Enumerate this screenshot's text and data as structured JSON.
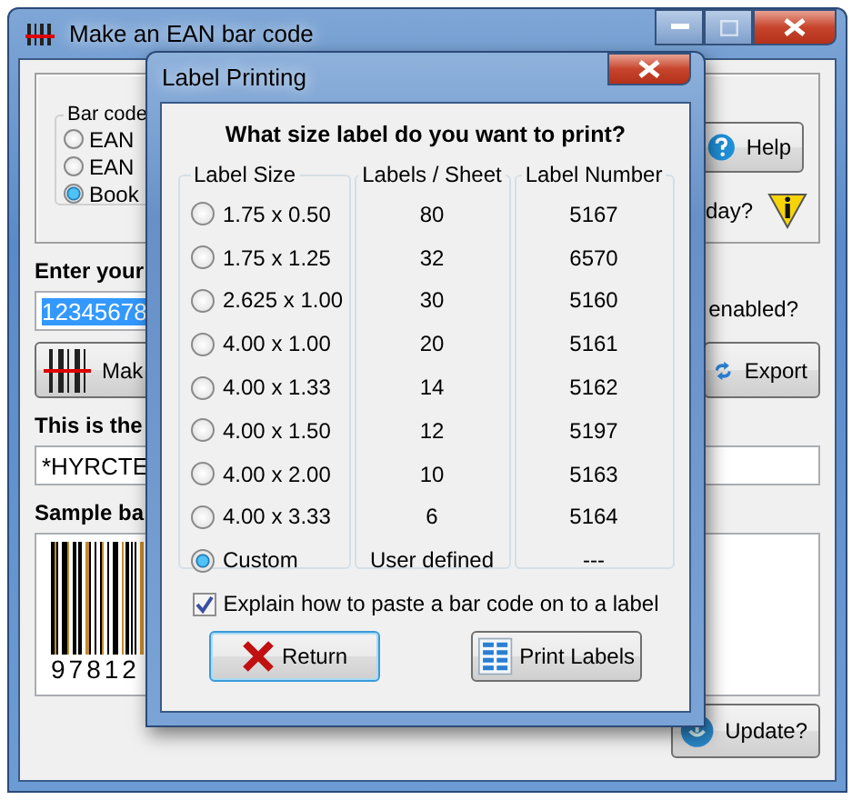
{
  "main_window": {
    "title": "Make an EAN bar code",
    "bar_code_group": {
      "label": "Bar code",
      "options": [
        {
          "label": "EAN",
          "selected": false
        },
        {
          "label": "EAN",
          "selected": false
        },
        {
          "label": "Book",
          "selected": true
        }
      ]
    },
    "help_button": "Help",
    "tip_text": "day?",
    "enter_label": "Enter your",
    "code_field": {
      "value": "12345678"
    },
    "enabled_text": "enabled?",
    "make_button": "Mak",
    "export_button": "Export",
    "result_label": "This is the",
    "result_field": {
      "value": "*HYRCTE"
    },
    "sample_label": "Sample ba",
    "sample_digits": "97812",
    "update_button": "Update?"
  },
  "dialog": {
    "title": "Label Printing",
    "heading": "What size label do you want to print?",
    "columns": [
      "Label Size",
      "Labels / Sheet",
      "Label Number"
    ],
    "rows": [
      {
        "size": "1.75 x 0.50",
        "per_sheet": "80",
        "number": "5167",
        "selected": false
      },
      {
        "size": "1.75 x 1.25",
        "per_sheet": "32",
        "number": "6570",
        "selected": false
      },
      {
        "size": "2.625 x 1.00",
        "per_sheet": "30",
        "number": "5160",
        "selected": false
      },
      {
        "size": "4.00 x 1.00",
        "per_sheet": "20",
        "number": "5161",
        "selected": false
      },
      {
        "size": "4.00 x 1.33",
        "per_sheet": "14",
        "number": "5162",
        "selected": false
      },
      {
        "size": "4.00 x 1.50",
        "per_sheet": "12",
        "number": "5197",
        "selected": false
      },
      {
        "size": "4.00 x 2.00",
        "per_sheet": "10",
        "number": "5163",
        "selected": false
      },
      {
        "size": "4.00 x 3.33",
        "per_sheet": "6",
        "number": "5164",
        "selected": false
      },
      {
        "size": "Custom",
        "per_sheet": "User defined",
        "number": "---",
        "selected": true
      }
    ],
    "explain_checkbox": {
      "label": "Explain how to paste a bar code on to a label",
      "checked": true
    },
    "buttons": [
      {
        "label": "Return",
        "kind": "return"
      },
      {
        "label": "Print Labels",
        "kind": "print"
      }
    ]
  }
}
